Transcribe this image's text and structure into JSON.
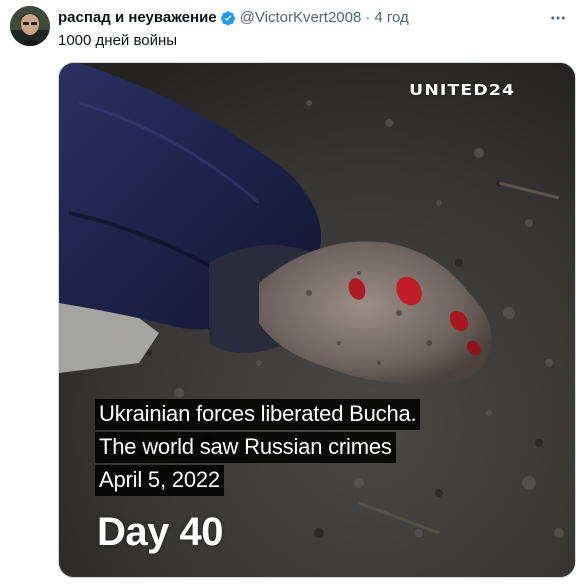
{
  "author": {
    "display_name": "распад и неуважение",
    "handle": "@VictorKvert2008",
    "separator": "·",
    "time": "4 год",
    "verified_icon": "verified-badge-icon",
    "avatar": "avatar-photo"
  },
  "tweet": {
    "text": "1000 дней войны"
  },
  "media": {
    "watermark": "UNITED24",
    "caption_lines": [
      "Ukrainian forces liberated Bucha.",
      "The world saw Russian crimes",
      "April 5, 2022"
    ],
    "day_label": "Day 40"
  },
  "colors": {
    "verified": "#1d9bf0",
    "text_primary": "#0f1419",
    "text_secondary": "#536471"
  },
  "menu": {
    "more_icon": "more-horizontal-icon"
  }
}
